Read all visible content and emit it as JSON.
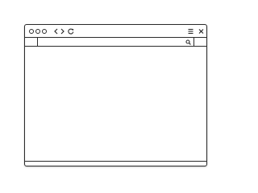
{
  "window": {
    "border_color": "#2b2b2b",
    "background": "#ffffff"
  },
  "titlebar": {
    "window_controls": [
      "circle-icon",
      "circle-icon",
      "circle-icon"
    ],
    "nav_icons": [
      "chevron-left-icon",
      "chevron-right-icon",
      "reload-icon"
    ],
    "right_icons": [
      "hamburger-menu-icon",
      "close-icon"
    ]
  },
  "address_bar": {
    "value": "",
    "placeholder": "",
    "search_icon": "search-icon"
  }
}
